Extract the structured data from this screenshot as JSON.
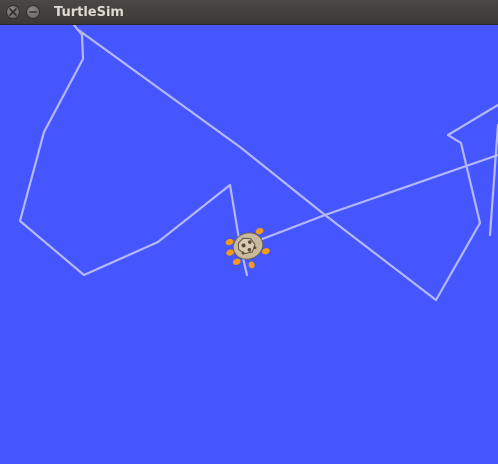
{
  "window": {
    "title": "TurtleSim",
    "close_icon": "close-icon",
    "minimize_icon": "minimize-icon"
  },
  "canvas": {
    "background_color": "#4556ff",
    "pen_color": "#b3b8ff",
    "turtle_icon": "turtle-icon"
  }
}
